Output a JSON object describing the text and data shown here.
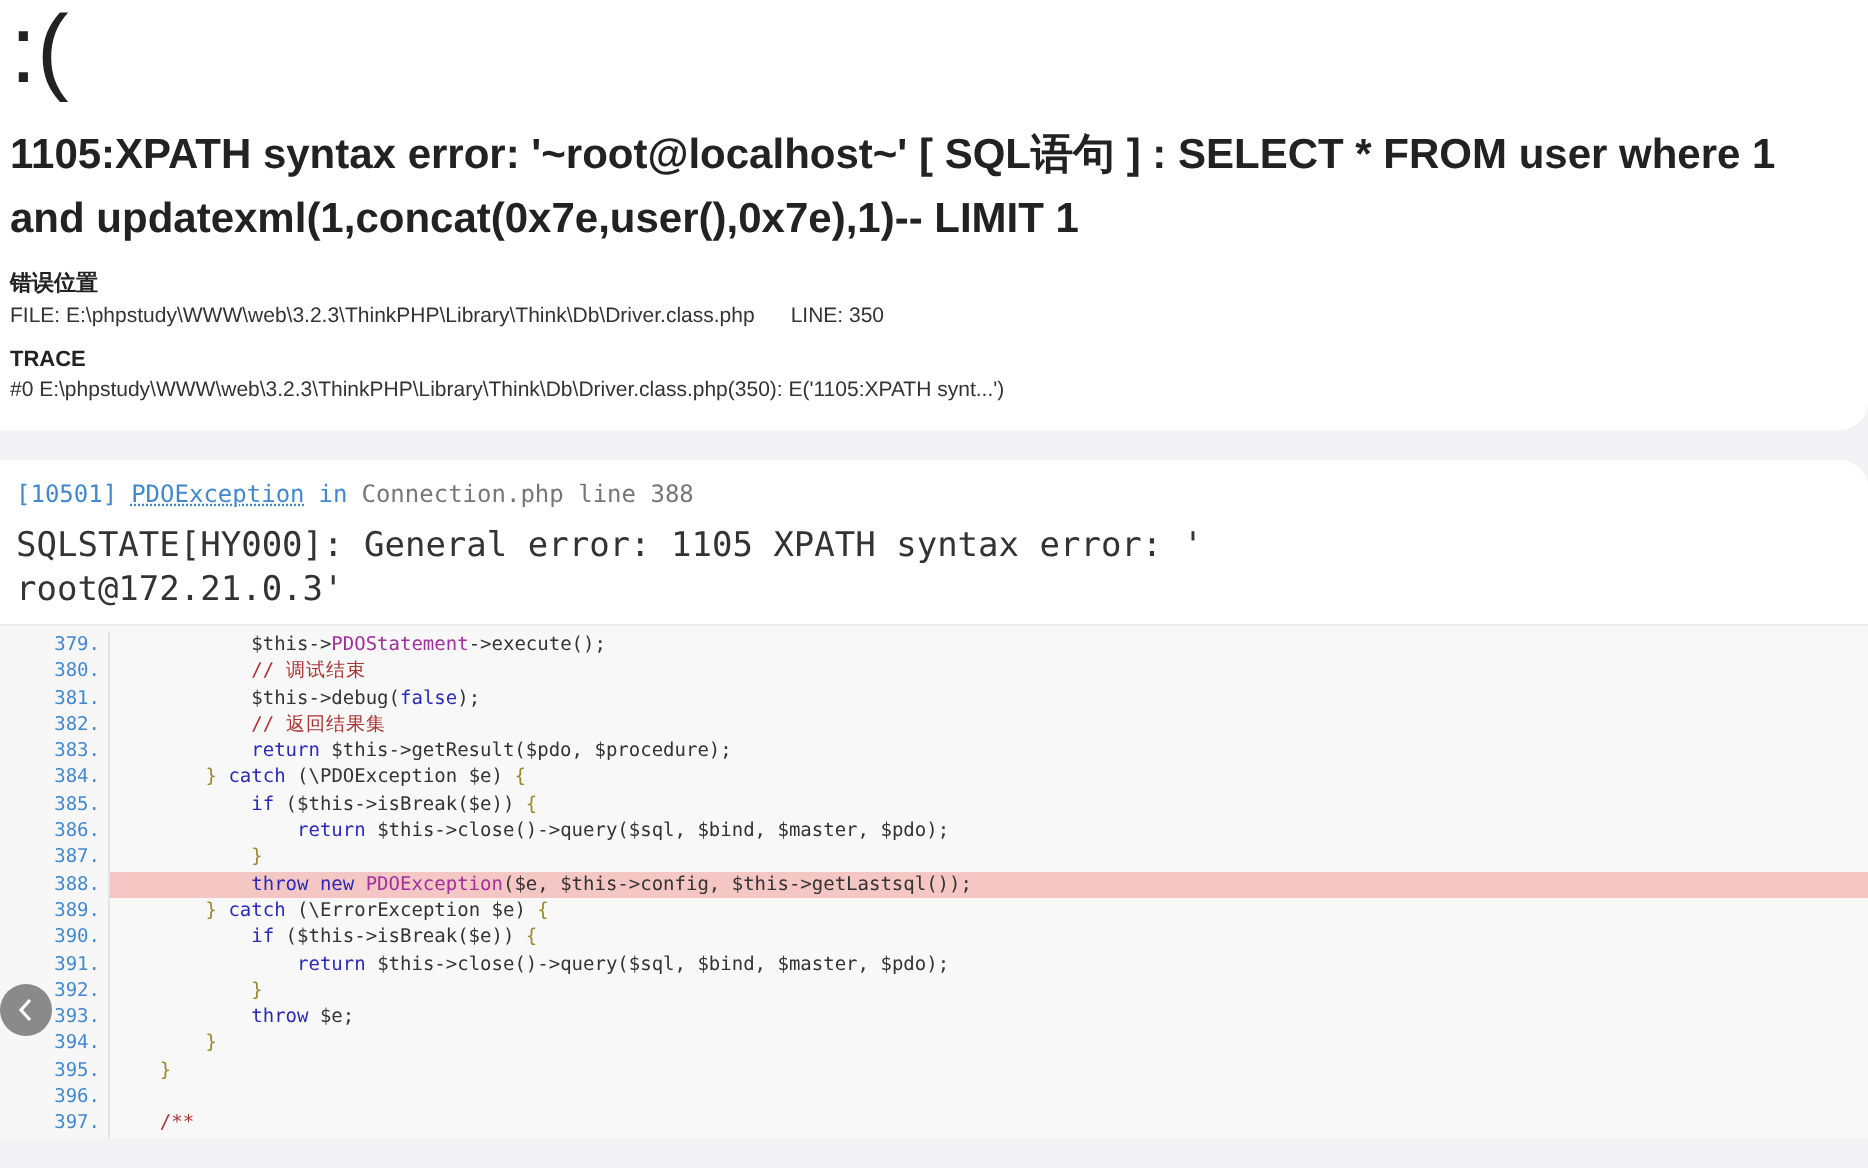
{
  "error_page": {
    "face": ":(",
    "message": "1105:XPATH syntax error: '~root@localhost~' [ SQL语句 ] : SELECT * FROM user where 1 and updatexml(1,concat(0x7e,user(),0x7e),1)-- LIMIT 1",
    "location_heading": "错误位置",
    "file": "FILE: E:\\phpstudy\\WWW\\web\\3.2.3\\ThinkPHP\\Library\\Think\\Db\\Driver.class.php",
    "line": "LINE: 350",
    "trace_heading": "TRACE",
    "trace": "#0 E:\\phpstudy\\WWW\\web\\3.2.3\\ThinkPHP\\Library\\Think\\Db\\Driver.class.php(350): E('1105:XPATH synt...')"
  },
  "exception": {
    "code": "[10501]",
    "class": "PDOException",
    "in": "in",
    "file": "Connection.php line 388",
    "message": "SQLSTATE[HY000]: General error: 1105 XPATH syntax error: ' root@172.21.0.3'"
  },
  "source": {
    "lines": [
      {
        "number": "379.",
        "highlighted": false,
        "segments": [
          {
            "kind": "plain",
            "text": "            $this->"
          },
          {
            "kind": "cls",
            "text": "PDOStatement"
          },
          {
            "kind": "plain",
            "text": "->execute();"
          }
        ]
      },
      {
        "number": "380.",
        "highlighted": false,
        "segments": [
          {
            "kind": "cm",
            "text": "            // 调试结束"
          }
        ]
      },
      {
        "number": "381.",
        "highlighted": false,
        "segments": [
          {
            "kind": "plain",
            "text": "            $this->debug("
          },
          {
            "kind": "kw",
            "text": "false"
          },
          {
            "kind": "plain",
            "text": ");"
          }
        ]
      },
      {
        "number": "382.",
        "highlighted": false,
        "segments": [
          {
            "kind": "cm",
            "text": "            // 返回结果集"
          }
        ]
      },
      {
        "number": "383.",
        "highlighted": false,
        "segments": [
          {
            "kind": "kw",
            "text": "            return"
          },
          {
            "kind": "plain",
            "text": " $this->getResult($pdo, $procedure);"
          }
        ]
      },
      {
        "number": "384.",
        "highlighted": false,
        "segments": [
          {
            "kind": "br",
            "text": "        }"
          },
          {
            "kind": "kw",
            "text": " catch"
          },
          {
            "kind": "plain",
            "text": " (\\PDOException $e) "
          },
          {
            "kind": "br",
            "text": "{"
          }
        ]
      },
      {
        "number": "385.",
        "highlighted": false,
        "segments": [
          {
            "kind": "kw",
            "text": "            if"
          },
          {
            "kind": "plain",
            "text": " ($this->isBreak($e)) "
          },
          {
            "kind": "br",
            "text": "{"
          }
        ]
      },
      {
        "number": "386.",
        "highlighted": false,
        "segments": [
          {
            "kind": "kw",
            "text": "                return"
          },
          {
            "kind": "plain",
            "text": " $this->close()->query($sql, $bind, $master, $pdo);"
          }
        ]
      },
      {
        "number": "387.",
        "highlighted": false,
        "segments": [
          {
            "kind": "br",
            "text": "            }"
          }
        ]
      },
      {
        "number": "388.",
        "highlighted": true,
        "segments": [
          {
            "kind": "kw",
            "text": "            throw new"
          },
          {
            "kind": "cls",
            "text": " PDOException"
          },
          {
            "kind": "plain",
            "text": "($e, $this->config, $this->getLastsql());"
          }
        ]
      },
      {
        "number": "389.",
        "highlighted": false,
        "segments": [
          {
            "kind": "br",
            "text": "        }"
          },
          {
            "kind": "kw",
            "text": " catch"
          },
          {
            "kind": "plain",
            "text": " (\\ErrorException $e) "
          },
          {
            "kind": "br",
            "text": "{"
          }
        ]
      },
      {
        "number": "390.",
        "highlighted": false,
        "segments": [
          {
            "kind": "kw",
            "text": "            if"
          },
          {
            "kind": "plain",
            "text": " ($this->isBreak($e)) "
          },
          {
            "kind": "br",
            "text": "{"
          }
        ]
      },
      {
        "number": "391.",
        "highlighted": false,
        "segments": [
          {
            "kind": "kw",
            "text": "                return"
          },
          {
            "kind": "plain",
            "text": " $this->close()->query($sql, $bind, $master, $pdo);"
          }
        ]
      },
      {
        "number": "392.",
        "highlighted": false,
        "segments": [
          {
            "kind": "br",
            "text": "            }"
          }
        ]
      },
      {
        "number": "393.",
        "highlighted": false,
        "segments": [
          {
            "kind": "kw",
            "text": "            throw"
          },
          {
            "kind": "plain",
            "text": " $e;"
          }
        ]
      },
      {
        "number": "394.",
        "highlighted": false,
        "segments": [
          {
            "kind": "br",
            "text": "        }"
          }
        ]
      },
      {
        "number": "395.",
        "highlighted": false,
        "segments": [
          {
            "kind": "br",
            "text": "    }"
          }
        ]
      },
      {
        "number": "396.",
        "highlighted": false
      },
      {
        "number": "397.",
        "highlighted": false,
        "segments": [
          {
            "kind": "cm",
            "text": "    /**"
          }
        ]
      }
    ]
  }
}
